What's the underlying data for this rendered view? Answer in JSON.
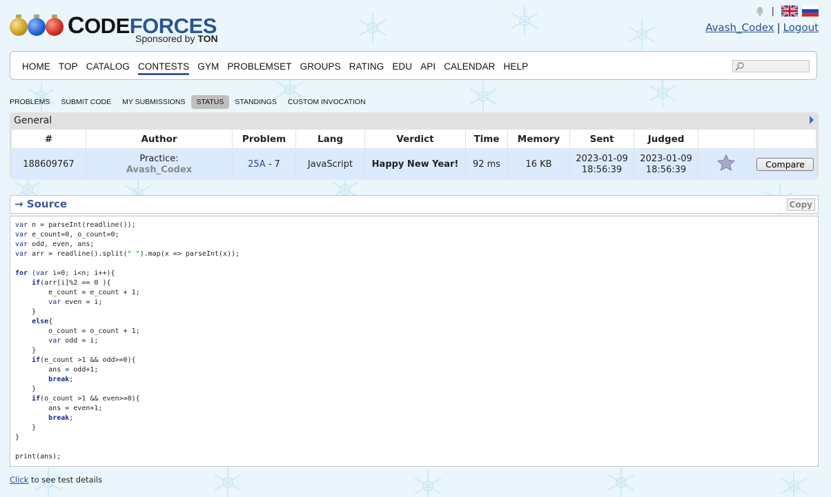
{
  "header": {
    "logo_main": "CODEFORCES",
    "logo_sponsor_prefix": "Sponsored by",
    "logo_sponsor_name": "TON",
    "user": "Avash_Codex",
    "logout": "Logout"
  },
  "menu": {
    "items": [
      "HOME",
      "TOP",
      "CATALOG",
      "CONTESTS",
      "GYM",
      "PROBLEMSET",
      "GROUPS",
      "RATING",
      "EDU",
      "API",
      "CALENDAR",
      "HELP"
    ],
    "active": "CONTESTS"
  },
  "submenu": {
    "items": [
      "PROBLEMS",
      "SUBMIT CODE",
      "MY SUBMISSIONS",
      "STATUS",
      "STANDINGS",
      "CUSTOM INVOCATION"
    ],
    "active": "STATUS"
  },
  "general": {
    "caption": "General",
    "headers": [
      "#",
      "Author",
      "Problem",
      "Lang",
      "Verdict",
      "Time",
      "Memory",
      "Sent",
      "Judged",
      "",
      ""
    ],
    "row": {
      "id": "188609767",
      "author_prefix": "Practice:",
      "author": "Avash_Codex",
      "problem_link": "25A",
      "problem_rest": " - 7",
      "lang": "JavaScript",
      "verdict": "Happy New Year!",
      "time": "92 ms",
      "memory": "16 KB",
      "sent_date": "2023-01-09",
      "sent_time": "18:56:39",
      "judged_date": "2023-01-09",
      "judged_time": "18:56:39",
      "compare": "Compare"
    }
  },
  "source": {
    "title": "→ Source",
    "copy": "Copy",
    "code": "var n = parseInt(readline());\nvar e_count=0, o_count=0;\nvar odd, even, ans;\nvar arr = readline().split(\" \").map(x => parseInt(x));\n\nfor (var i=0; i<n; i++){\n    if(arr[i]%2 == 0 ){\n        e_count = e_count + 1;\n        var even = i;\n    }\n    else{\n        o_count = o_count + 1;\n        var odd = i;\n    }\n    if(e_count >1 && odd>=0){\n        ans = odd+1;\n        break;\n    }\n    if(o_count >1 && even>=0){\n        ans = even+1;\n        break;\n    }\n}\n\nprint(ans);"
  },
  "footer": {
    "click_link": "Click",
    "click_rest": " to see test details"
  },
  "colors": {
    "accent": "#3b5998",
    "verdict": "#00aa00",
    "row_bg": "#dbeafc"
  },
  "icons": [
    "bell-icon",
    "uk-flag-icon",
    "russia-flag-icon",
    "search-icon",
    "star-icon",
    "arrow-right-icon"
  ]
}
